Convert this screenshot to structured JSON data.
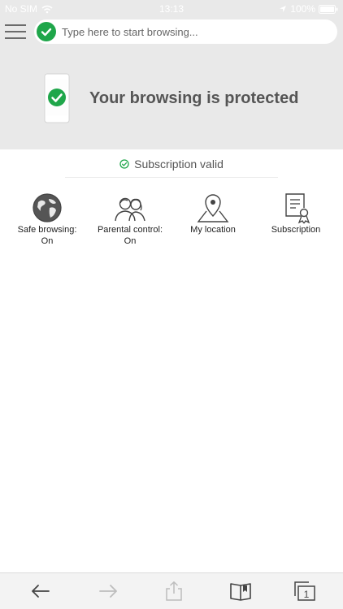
{
  "status_bar": {
    "carrier": "No SIM",
    "time": "13:13",
    "battery": "100%"
  },
  "browser": {
    "url_placeholder": "Type here to start browsing...",
    "accent_color": "#1fa64a"
  },
  "protection": {
    "title": "Your browsing is protected"
  },
  "subscription": {
    "status_text": "Subscription valid"
  },
  "features": [
    {
      "label": "Safe browsing:",
      "value": "On",
      "icon": "globe-icon"
    },
    {
      "label": "Parental control:",
      "value": "On",
      "icon": "family-icon"
    },
    {
      "label": "My location",
      "value": "",
      "icon": "location-pin-icon"
    },
    {
      "label": "Subscription",
      "value": "",
      "icon": "certificate-icon"
    }
  ],
  "toolbar": {
    "icons": [
      "back-arrow-icon",
      "forward-arrow-icon",
      "share-icon",
      "bookmarks-icon",
      "tabs-icon"
    ],
    "tab_count": "1"
  }
}
